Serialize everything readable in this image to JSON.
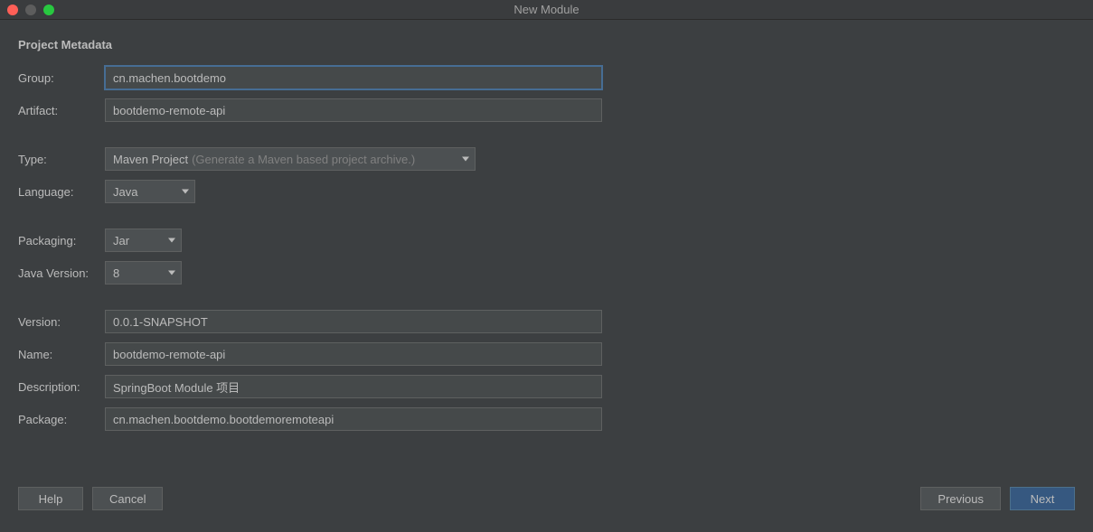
{
  "window": {
    "title": "New Module"
  },
  "section": {
    "title": "Project Metadata"
  },
  "labels": {
    "group": "Group:",
    "artifact": "Artifact:",
    "type": "Type:",
    "language": "Language:",
    "packaging": "Packaging:",
    "javaVersion": "Java Version:",
    "version": "Version:",
    "name": "Name:",
    "description": "Description:",
    "package": "Package:"
  },
  "values": {
    "group": "cn.machen.bootdemo",
    "artifact": "bootdemo-remote-api",
    "type": "Maven Project",
    "typeHint": "(Generate a Maven based project archive.)",
    "language": "Java",
    "packaging": "Jar",
    "javaVersion": "8",
    "version": "0.0.1-SNAPSHOT",
    "name": "bootdemo-remote-api",
    "description": "SpringBoot Module 项目",
    "package": "cn.machen.bootdemo.bootdemoremoteapi"
  },
  "buttons": {
    "help": "Help",
    "cancel": "Cancel",
    "previous": "Previous",
    "next": "Next"
  }
}
